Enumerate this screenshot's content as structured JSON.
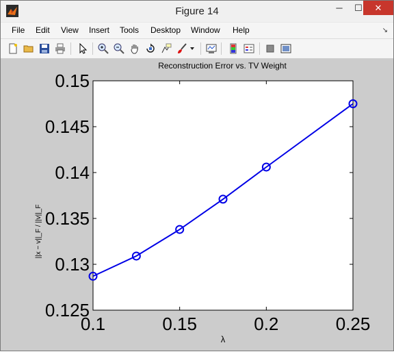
{
  "window": {
    "title": "Figure 14",
    "minimize_glyph": "─",
    "maximize_glyph": "☐",
    "close_glyph": "✕"
  },
  "menu": {
    "items": [
      "File",
      "Edit",
      "View",
      "Insert",
      "Tools",
      "Desktop",
      "Window",
      "Help"
    ],
    "dock_arrow": "↘"
  },
  "toolbar": {
    "icons": [
      "new-figure-icon",
      "open-file-icon",
      "save-icon",
      "print-icon",
      "pointer-icon",
      "zoom-in-icon",
      "zoom-out-icon",
      "pan-icon",
      "rotate-icon",
      "data-cursor-icon",
      "brush-icon",
      "link-plot-icon",
      "colorbar-icon",
      "legend-icon",
      "hide-plot-tools-icon",
      "show-plot-tools-icon"
    ]
  },
  "chart_data": {
    "type": "line",
    "title": "Reconstruction Error vs. TV Weight",
    "xlabel": "λ",
    "ylabel": "||x − v||_F / ||v||_F",
    "xlim": [
      0.1,
      0.25
    ],
    "ylim": [
      0.125,
      0.15
    ],
    "xticks": [
      "0.1",
      "0.15",
      "0.2",
      "0.25"
    ],
    "yticks": [
      "0.125",
      "0.13",
      "0.135",
      "0.14",
      "0.145",
      "0.15"
    ],
    "grid": false,
    "marker": "circle",
    "color": "#0000e6",
    "series": [
      {
        "x": [
          0.1,
          0.125,
          0.15,
          0.175,
          0.2,
          0.25
        ],
        "y": [
          0.1287,
          0.1309,
          0.1338,
          0.1371,
          0.1406,
          0.1475
        ]
      }
    ]
  }
}
